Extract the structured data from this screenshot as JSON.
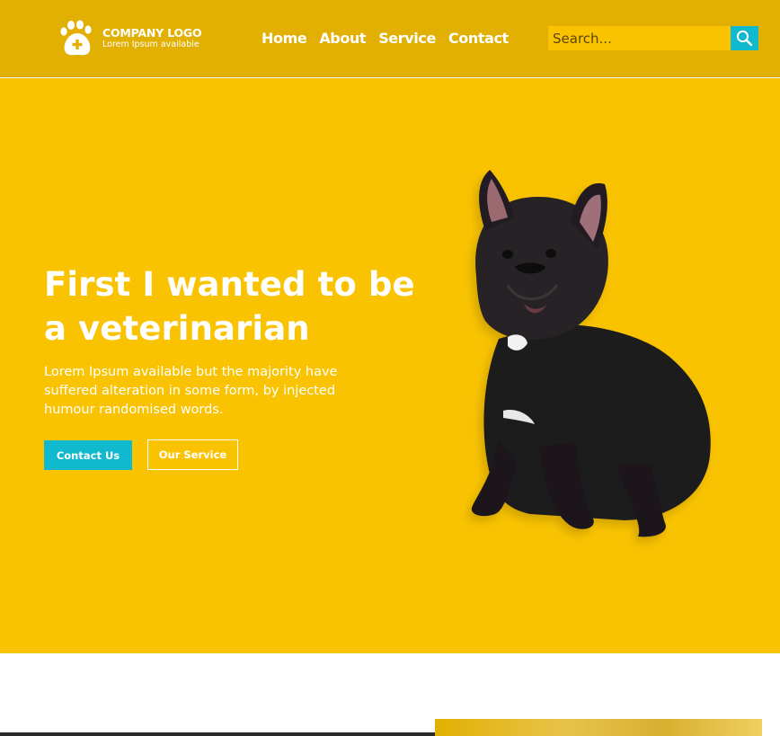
{
  "brand": {
    "title": "COMPANY LOGO",
    "subtitle": "Lorem Ipsum available"
  },
  "nav": {
    "items": [
      "Home",
      "About",
      "Service",
      "Contact"
    ]
  },
  "search": {
    "placeholder": "Search..."
  },
  "hero": {
    "title": "First I wanted to be a veterinarian",
    "text": "Lorem Ipsum available but the majority have suffered alteration in some form, by injected humour randomised words.",
    "primary_button": "Contact Us",
    "secondary_button": "Our Service"
  },
  "colors": {
    "header": "#e1b002",
    "hero": "#f9c301",
    "accent": "#10b9ce"
  }
}
